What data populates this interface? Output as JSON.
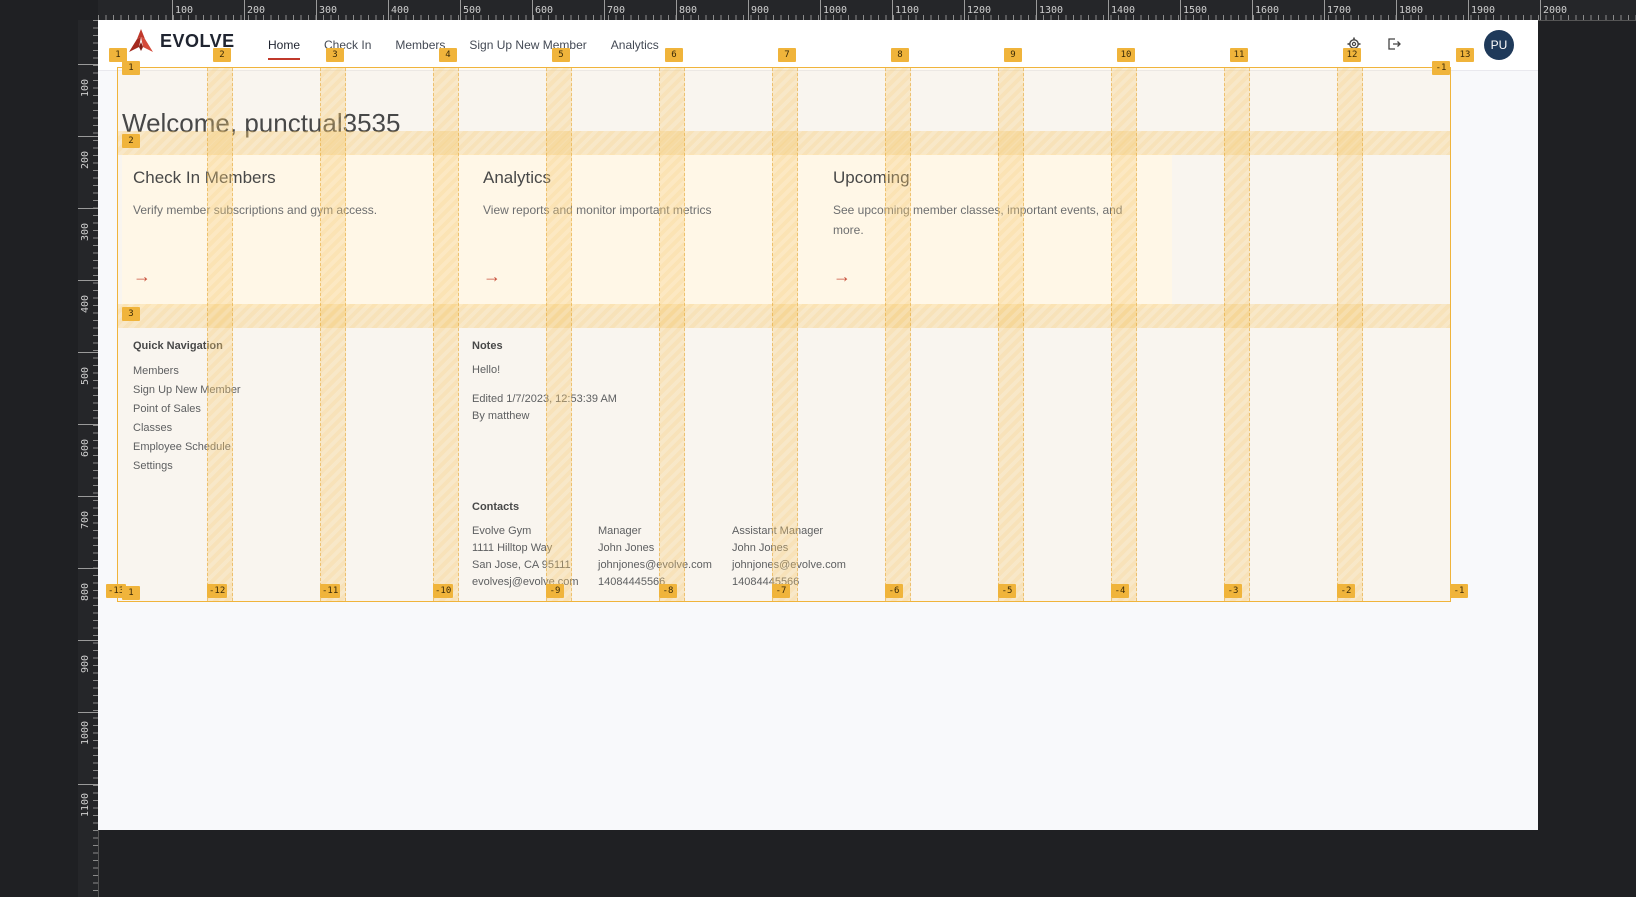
{
  "ruler": {
    "top_ticks": [
      "100",
      "200",
      "300",
      "400",
      "500",
      "600",
      "700",
      "800",
      "900",
      "1000",
      "1100",
      "1200",
      "1300",
      "1400",
      "1500",
      "1600",
      "1700",
      "1800",
      "1900",
      "2000"
    ],
    "left_ticks": [
      "100",
      "200",
      "300",
      "400",
      "500",
      "600",
      "700",
      "800",
      "900",
      "1000",
      "1100"
    ]
  },
  "nav": {
    "logo_text": "EVOLVE",
    "links": [
      "Home",
      "Check In",
      "Members",
      "Sign Up New Member",
      "Analytics"
    ],
    "active": "Home",
    "settings_icon": "gear-icon",
    "logout_icon": "logout-icon",
    "avatar_initials": "PU"
  },
  "welcome": "Welcome, punctual3535",
  "cards": [
    {
      "title": "Check In Members",
      "description": "Verify member subscriptions and gym access.",
      "arrow": "→"
    },
    {
      "title": "Analytics",
      "description": "View reports and monitor important metrics",
      "arrow": "→"
    },
    {
      "title": "Upcoming",
      "description": "See upcoming member classes, important events, and more.",
      "arrow": "→"
    }
  ],
  "quick_navigation": {
    "title": "Quick Navigation",
    "items": [
      "Members",
      "Sign Up New Member",
      "Point of Sales",
      "Classes",
      "Employee Schedule",
      "Settings"
    ]
  },
  "notes": {
    "title": "Notes",
    "body": "Hello!",
    "edited": "Edited 1/7/2023, 12:53:39 AM",
    "author": "By matthew"
  },
  "contacts": {
    "title": "Contacts",
    "columns": [
      [
        "Evolve Gym",
        "1111 Hilltop Way",
        "San Jose, CA 95111",
        "evolvesj@evolve.com"
      ],
      [
        "Manager",
        "John Jones",
        "johnjones@evolve.com",
        "14084445566"
      ],
      [
        "Assistant Manager",
        "John Jones",
        "johnjones@evolve.com",
        "14084445566"
      ]
    ]
  },
  "overlay": {
    "top_labels": [
      "1",
      "2",
      "3",
      "4",
      "5",
      "6",
      "7",
      "8",
      "9",
      "10",
      "11",
      "12",
      "13"
    ],
    "bottom_labels": [
      "-13",
      "-12",
      "-11",
      "-10",
      "-9",
      "-8",
      "-7",
      "-6",
      "-5",
      "-4",
      "-3",
      "-2",
      "-1"
    ],
    "row_labels": [
      "1",
      "2",
      "3"
    ],
    "corner_top_right": "-1",
    "corner_bottom_left": "1",
    "accent": "#f0b43b"
  }
}
